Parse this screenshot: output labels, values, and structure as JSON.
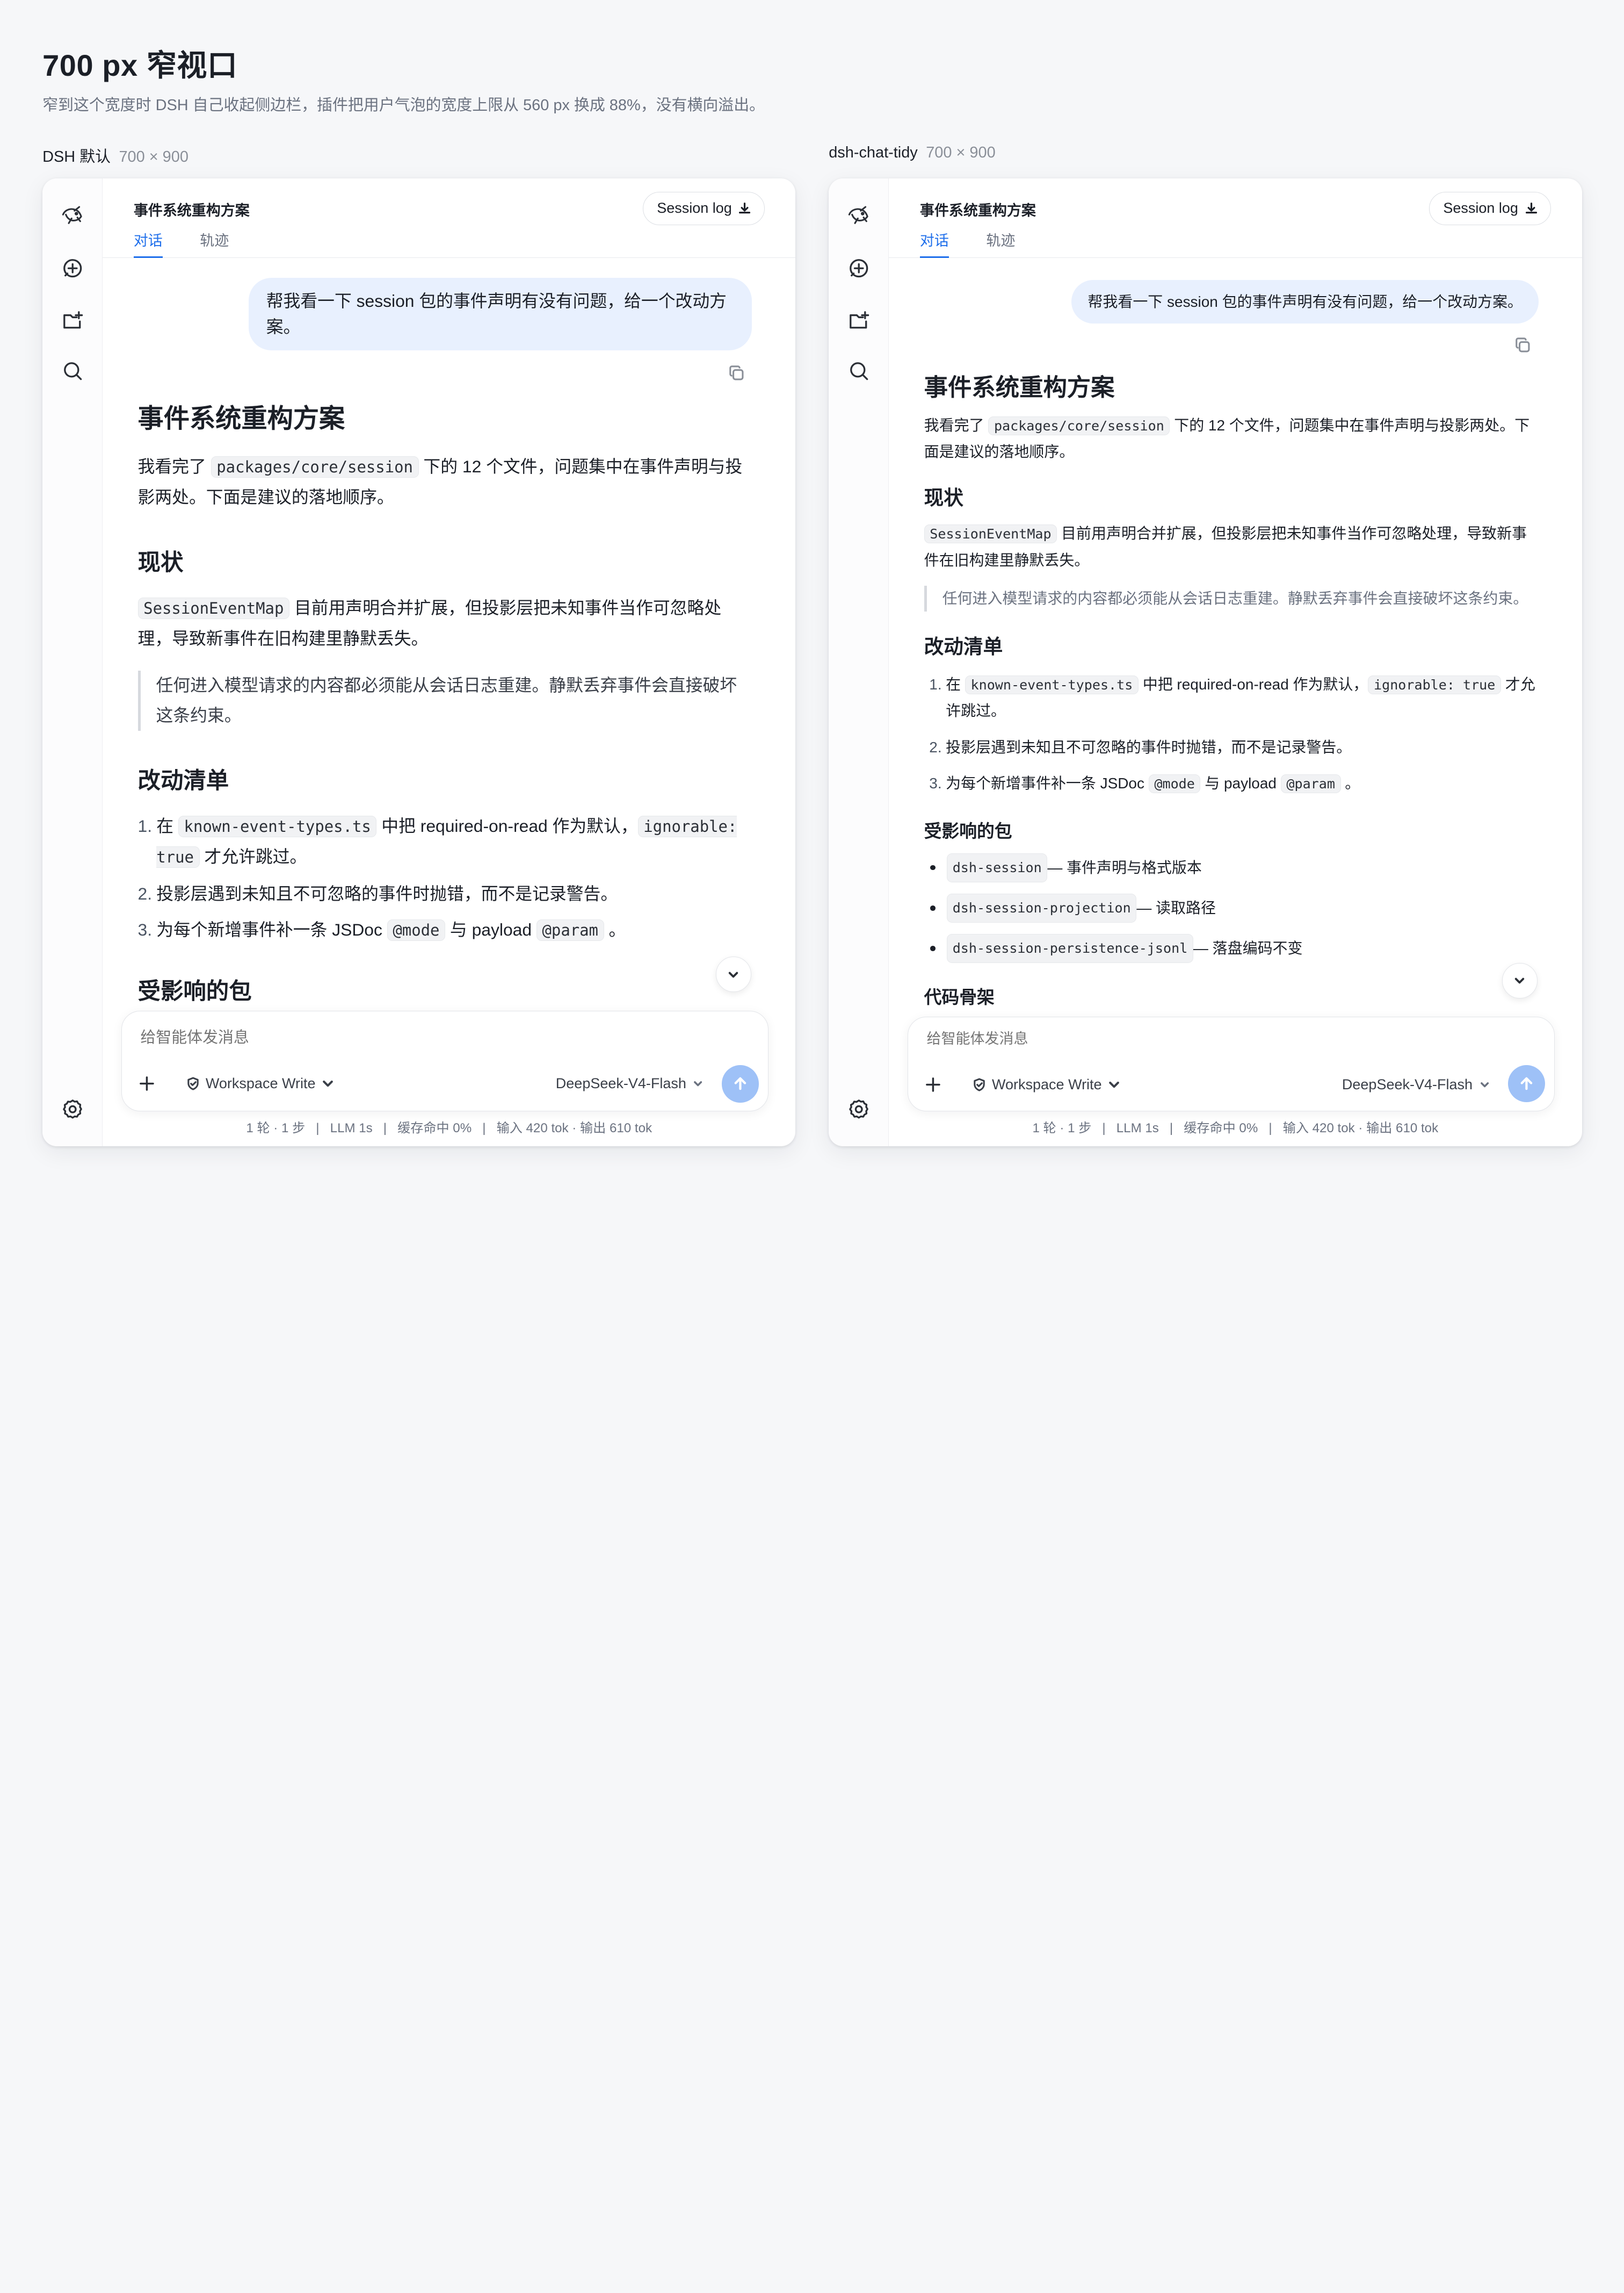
{
  "page": {
    "title": "700 px 窄视口",
    "subtitle": "窄到这个宽度时 DSH 自己收起侧边栏，插件把用户气泡的宽度上限从 560 px 换成 88%，没有横向溢出。"
  },
  "panels": [
    {
      "label": "DSH 默认",
      "dims": "700 × 900",
      "window_title": "事件系统重构方案",
      "tab_chat": "对话",
      "tab_trace": "轨迹",
      "session_log": "Session log",
      "user_message": "帮我看一下 session 包的事件声明有没有问题，给一个改动方案。",
      "h1": "事件系统重构方案",
      "intro_a": "我看完了 ",
      "intro_code": "packages/core/session",
      "intro_b": " 下的 12 个文件，问题集中在事件声明与投影两处。下面是建议的落地顺序。",
      "h2_status": "现状",
      "status_code": "SessionEventMap",
      "status_text": " 目前用声明合并扩展，但投影层把未知事件当作可忽略处理，导致新事件在旧构建里静默丢失。",
      "quote": "任何进入模型请求的内容都必须能从会话日志重建。静默丢弃事件会直接破坏这条约束。",
      "h2_changes": "改动清单",
      "step1_num": "1.",
      "step1_a": "在 ",
      "step1_code1": "known-event-types.ts",
      "step1_b": " 中把 required-on-read 作为默认，",
      "step1_code2": "ignorable: true",
      "step1_c": " 才允许跳过。",
      "step2_num": "2.",
      "step2": "投影层遇到未知且不可忽略的事件时抛错，而不是记录警告。",
      "step3_num": "3.",
      "step3_a": "为每个新增事件补一条 JSDoc ",
      "step3_code1": "@mode",
      "step3_b": " 与 payload ",
      "step3_code2": "@param",
      "step3_c": " 。",
      "h2_pkgs": "受影响的包",
      "composer_placeholder": "给智能体发消息",
      "mode": "Workspace Write",
      "model": "DeepSeek-V4-Flash",
      "stats": "1 轮 · 1 步   |   LLM 1s   |   缓存命中 0%   |   输入 420 tok · 输出 610 tok"
    },
    {
      "label": "dsh-chat-tidy",
      "dims": "700 × 900",
      "window_title": "事件系统重构方案",
      "tab_chat": "对话",
      "tab_trace": "轨迹",
      "session_log": "Session log",
      "user_message": "帮我看一下 session 包的事件声明有没有问题，给一个改动方案。",
      "h1": "事件系统重构方案",
      "intro_a": "我看完了 ",
      "intro_code": "packages/core/session",
      "intro_b": " 下的 12 个文件，问题集中在事件声明与投影两处。下面是建议的落地顺序。",
      "h2_status": "现状",
      "status_code": "SessionEventMap",
      "status_text": " 目前用声明合并扩展，但投影层把未知事件当作可忽略处理，导致新事件在旧构建里静默丢失。",
      "quote": "任何进入模型请求的内容都必须能从会话日志重建。静默丢弃事件会直接破坏这条约束。",
      "h2_changes": "改动清单",
      "step1_num": "1.",
      "step1_a": "在 ",
      "step1_code1": "known-event-types.ts",
      "step1_b": " 中把 required-on-read 作为默认，",
      "step1_code2": "ignorable: true",
      "step1_c": " 才允许跳过。",
      "step2_num": "2.",
      "step2": "投影层遇到未知且不可忽略的事件时抛错，而不是记录警告。",
      "step3_num": "3.",
      "step3_a": "为每个新增事件补一条 JSDoc ",
      "step3_code1": "@mode",
      "step3_b": " 与 payload ",
      "step3_code2": "@param",
      "step3_c": " 。",
      "h2_pkgs": "受影响的包",
      "packages": [
        {
          "code": "dsh-session",
          "desc": " — 事件声明与格式版本"
        },
        {
          "code": "dsh-session-projection",
          "desc": " — 读取路径"
        },
        {
          "code": "dsh-session-persistence-jsonl",
          "desc": " — 落盘编码不变"
        }
      ],
      "h2_skeleton": "代码骨架",
      "composer_placeholder": "给智能体发消息",
      "mode": "Workspace Write",
      "model": "DeepSeek-V4-Flash",
      "stats": "1 轮 · 1 步   |   LLM 1s   |   缓存命中 0%   |   输入 420 tok · 输出 610 tok"
    }
  ],
  "icons": [
    "whale-logo-icon",
    "new-chat-icon",
    "new-folder-icon",
    "search-icon",
    "settings-icon",
    "copy-icon",
    "download-icon",
    "chevron-down-icon",
    "plus-icon",
    "shield-icon",
    "send-arrow-icon"
  ],
  "colors": {
    "accent": "#1f6feb",
    "bubble": "#e8f0fe",
    "send": "#9ec1f7"
  }
}
